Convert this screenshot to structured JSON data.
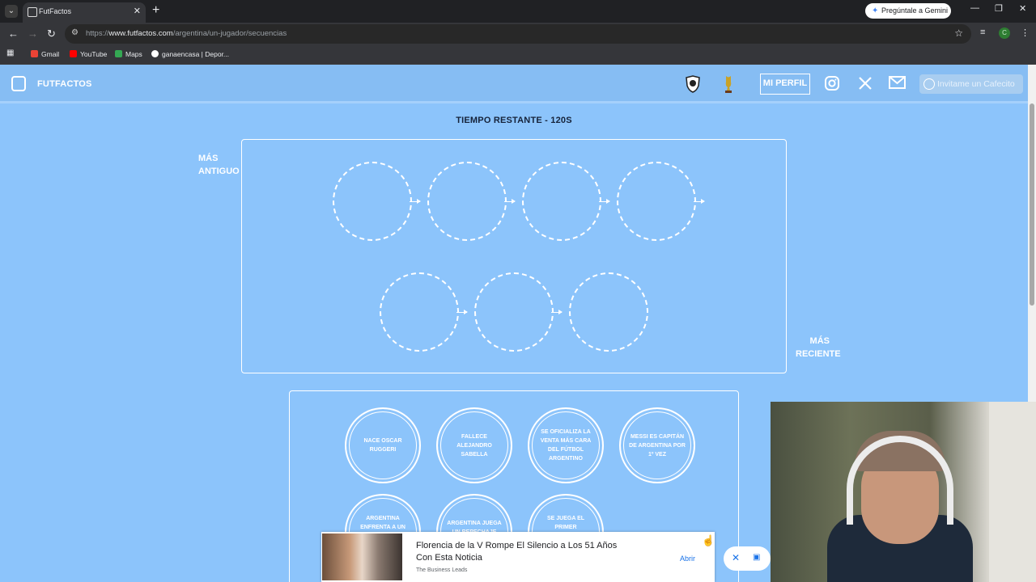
{
  "browser": {
    "tab_title": "FutFactos",
    "url_prefix": "https://",
    "url_domain": "www.futfactos.com",
    "url_path": "/argentina/un-jugador/secuencias",
    "gemini_label": "Pregúntale a Gemini",
    "profile_initial": "C",
    "bookmarks": [
      "Gmail",
      "YouTube",
      "Maps",
      "ganaencasa | Depor..."
    ]
  },
  "header": {
    "logo": "FUTFACTOS",
    "profile_button": "MI PERFIL",
    "cafecito": "Invitame un Cafecito"
  },
  "game": {
    "timer": "TIEMPO RESTANTE - 120S",
    "label_oldest": "MÁS\nANTIGUO",
    "label_newest": "MÁS\nRECIENTE",
    "events": [
      "NACE OSCAR RUGGERI",
      "FALLECE ALEJANDRO SABELLA",
      "SE OFICIALIZA LA VENTA MÁS CARA DEL FÚTBOL ARGENTINO",
      "MESSI ES CAPITÁN DE ARGENTINA POR 1º VEZ",
      "ARGENTINA ENFRENTA A UN PAÍS AFRICANO POR",
      "ARGENTINA JUEGA UN REPECHAJE PARA IR AL",
      "SE JUEGA EL PRIMER ARGENTINA-BRASIL EN"
    ]
  },
  "ad": {
    "title": "Florencia de la V Rompe El Silencio a Los 51 Años Con Esta Noticia",
    "source": "The Business Leads",
    "open": "Abrir"
  },
  "colors": {
    "page_bg": "#8cc4fb",
    "header_bg": "#86bdf3",
    "accent_text": "#16233a"
  }
}
